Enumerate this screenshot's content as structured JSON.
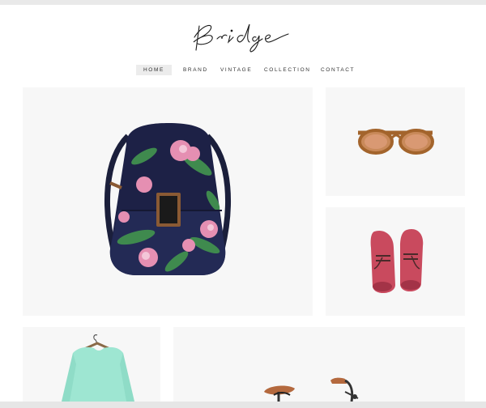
{
  "brand": {
    "logo_text": "Bridge"
  },
  "nav": {
    "items": [
      {
        "label": "HOME",
        "active": true
      },
      {
        "label": "BRAND",
        "active": false
      },
      {
        "label": "VINTAGE",
        "active": false
      },
      {
        "label": "COLLECTION",
        "active": false
      },
      {
        "label": "CONTACT",
        "active": false
      }
    ]
  },
  "gallery": {
    "items": [
      {
        "product": "backpack"
      },
      {
        "product": "sunglasses"
      },
      {
        "product": "shoes"
      },
      {
        "product": "sweater"
      },
      {
        "product": "bicycle"
      }
    ]
  },
  "colors": {
    "tile_bg": "#f7f7f7",
    "nav_active_bg": "#ececec",
    "text": "#333333"
  }
}
